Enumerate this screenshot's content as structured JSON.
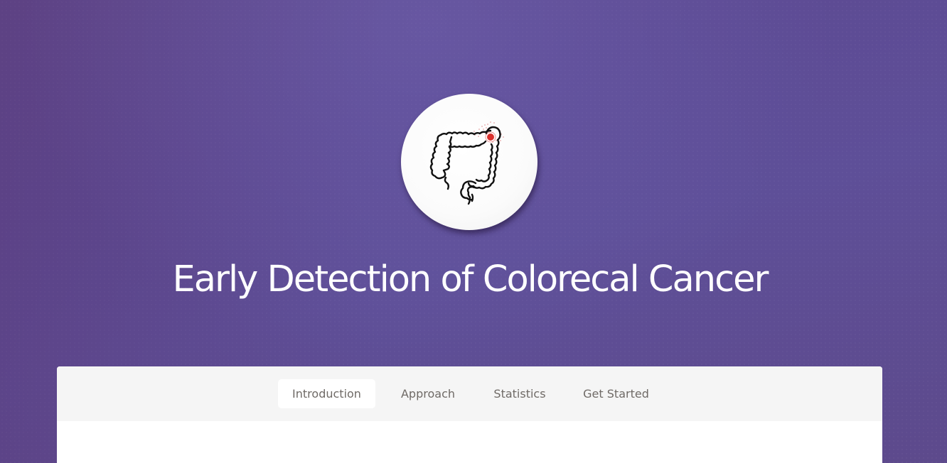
{
  "hero": {
    "title": "Early Detection of Colorecal Cancer",
    "logo_icon": "colon-icon",
    "highlight_color": "#d9302c",
    "background_color": "#5e4b92"
  },
  "nav": {
    "tabs": [
      {
        "label": "Introduction",
        "active": true
      },
      {
        "label": "Approach",
        "active": false
      },
      {
        "label": "Statistics",
        "active": false
      },
      {
        "label": "Get Started",
        "active": false
      }
    ]
  }
}
